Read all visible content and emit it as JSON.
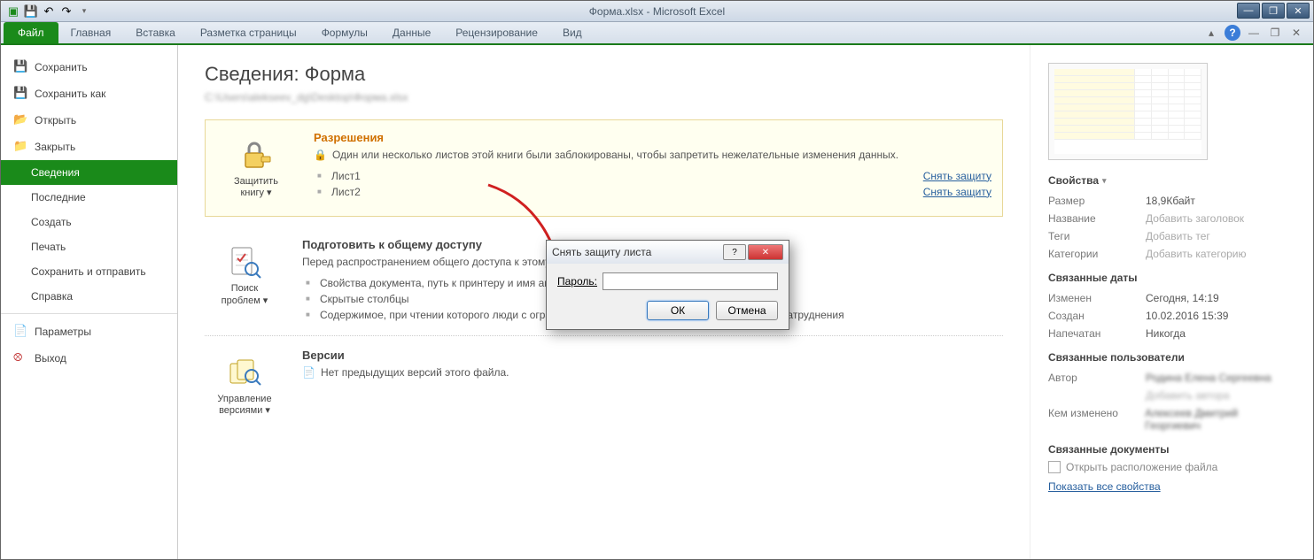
{
  "window": {
    "title": "Форма.xlsx - Microsoft Excel",
    "minimize": "—",
    "restore": "❐",
    "close": "✕"
  },
  "ribbon": {
    "file": "Файл",
    "tabs": [
      "Главная",
      "Вставка",
      "Разметка страницы",
      "Формулы",
      "Данные",
      "Рецензирование",
      "Вид"
    ]
  },
  "sidebar": [
    {
      "label": "Сохранить",
      "icon": "💾"
    },
    {
      "label": "Сохранить как",
      "icon": "💾"
    },
    {
      "label": "Открыть",
      "icon": "📂"
    },
    {
      "label": "Закрыть",
      "icon": "📁"
    },
    {
      "label": "Сведения",
      "selected": true
    },
    {
      "label": "Последние"
    },
    {
      "label": "Создать"
    },
    {
      "label": "Печать"
    },
    {
      "label": "Сохранить и отправить"
    },
    {
      "label": "Справка"
    },
    {
      "label": "Параметры",
      "icon": "📄"
    },
    {
      "label": "Выход",
      "icon": "�× "
    }
  ],
  "info": {
    "heading": "Сведения: Форма",
    "path": "C:\\Users\\alekseev_dg\\Desktop\\Форма.xlsx"
  },
  "permissions": {
    "btn": "Защитить книгу ▾",
    "title": "Разрешения",
    "desc": "Один или несколько листов этой книги были заблокированы, чтобы запретить нежелательные изменения данных.",
    "sheets": [
      {
        "name": "Лист1",
        "link": "Снять защиту"
      },
      {
        "name": "Лист2",
        "link": "Снять защиту"
      }
    ]
  },
  "prepare": {
    "btn": "Поиск проблем ▾",
    "title": "Подготовить к общему доступу",
    "desc": "Перед распространением общего доступа к этому файлу необходимо учесть, что он содержит:",
    "items": [
      "Свойства документа, путь к принтеру и имя автора",
      "Скрытые столбцы",
      "Содержимое, при чтении которого люди с ограниченными возможностями будут испытывать затруднения"
    ]
  },
  "versions": {
    "btn": "Управление версиями ▾",
    "title": "Версии",
    "desc": "Нет предыдущих версий этого файла."
  },
  "props": {
    "header": "Свойства",
    "size_k": "Размер",
    "size_v": "18,9Кбайт",
    "title_k": "Название",
    "title_v": "Добавить заголовок",
    "tags_k": "Теги",
    "tags_v": "Добавить тег",
    "cat_k": "Категории",
    "cat_v": "Добавить категорию",
    "dates_h": "Связанные даты",
    "mod_k": "Изменен",
    "mod_v": "Сегодня, 14:19",
    "created_k": "Создан",
    "created_v": "10.02.2016 15:39",
    "printed_k": "Напечатан",
    "printed_v": "Никогда",
    "users_h": "Связанные пользователи",
    "author_k": "Автор",
    "author_v": "Родина Елена Сергеевна",
    "addauthor": "Добавить автора",
    "changed_k": "Кем изменено",
    "changed_v": "Алексеев Дмитрий Георгиевич",
    "docs_h": "Связанные документы",
    "openloc": "Открыть расположение файла",
    "showall": "Показать все свойства"
  },
  "dialog": {
    "title": "Снять защиту листа",
    "label": "Пароль:",
    "ok": "ОК",
    "cancel": "Отмена"
  }
}
